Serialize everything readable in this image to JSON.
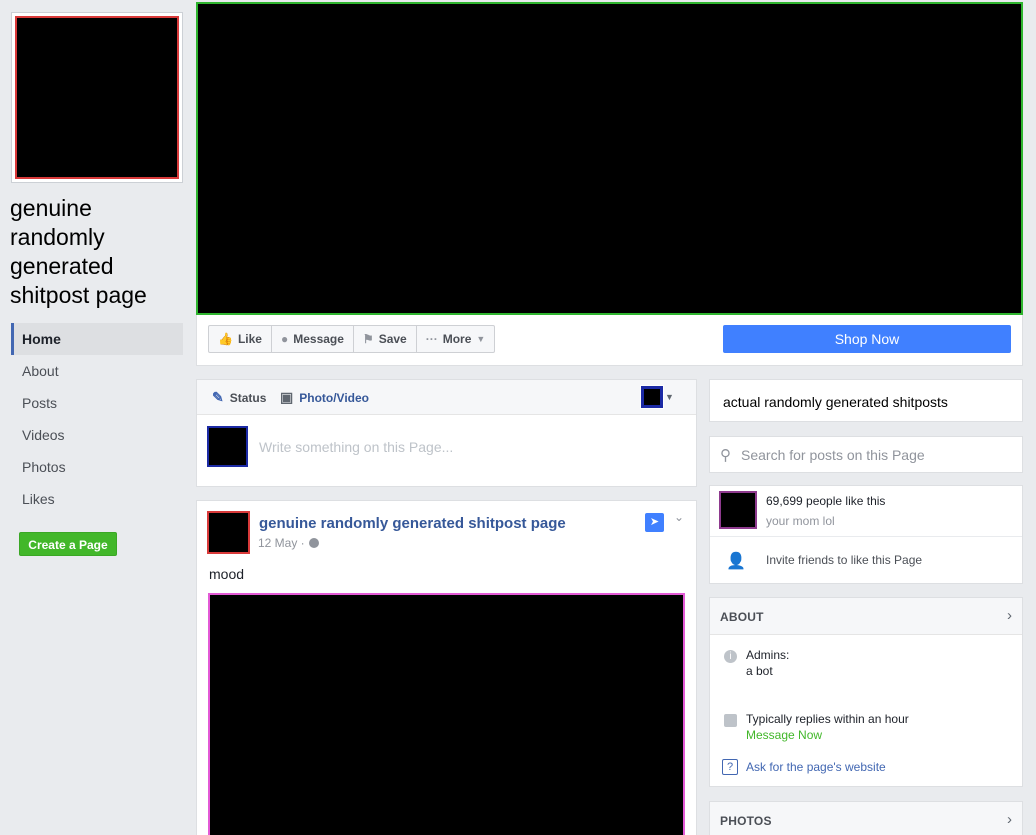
{
  "page": {
    "name": "genuine randomly generated shitpost page"
  },
  "left_nav": {
    "items": [
      {
        "label": "Home",
        "active": true
      },
      {
        "label": "About"
      },
      {
        "label": "Posts"
      },
      {
        "label": "Videos"
      },
      {
        "label": "Photos"
      },
      {
        "label": "Likes"
      }
    ],
    "create_page_label": "Create a Page"
  },
  "action_bar": {
    "like_label": "Like",
    "message_label": "Message",
    "save_label": "Save",
    "more_label": "More",
    "shop_now_label": "Shop Now"
  },
  "composer": {
    "status_tab": "Status",
    "photo_tab": "Photo/Video",
    "placeholder": "Write something on this Page..."
  },
  "post": {
    "author": "genuine randomly generated shitpost page",
    "date": "12 May ·",
    "text": "mood"
  },
  "sidebar": {
    "about_line": "actual randomly generated shitposts",
    "search_placeholder": "Search for posts on this Page",
    "likes_count": "69,699 people like this",
    "likes_sub": "your mom lol",
    "invite_text": "Invite friends to like this Page",
    "about_title": "ABOUT",
    "admins_label": "Admins:",
    "admins_value": "a bot",
    "replies_text": "Typically replies within an hour",
    "message_now": "Message Now",
    "website_link": "Ask for the page's website",
    "photos_title": "PHOTOS"
  },
  "colors": {
    "brand_blue": "#4080ff",
    "create_green": "#42b72a",
    "cover_border": "#2fb52f",
    "profile_border": "#d93a3a",
    "media_border": "#e35ad6"
  },
  "icons": {
    "like": "thumbs-up-icon",
    "message": "messenger-icon",
    "save": "bookmark-icon",
    "more": "ellipsis-icon",
    "status": "pencil-icon",
    "photo": "camera-icon",
    "search": "search-icon",
    "invite": "add-friend-icon",
    "pin": "pin-icon",
    "globe": "globe-icon"
  }
}
